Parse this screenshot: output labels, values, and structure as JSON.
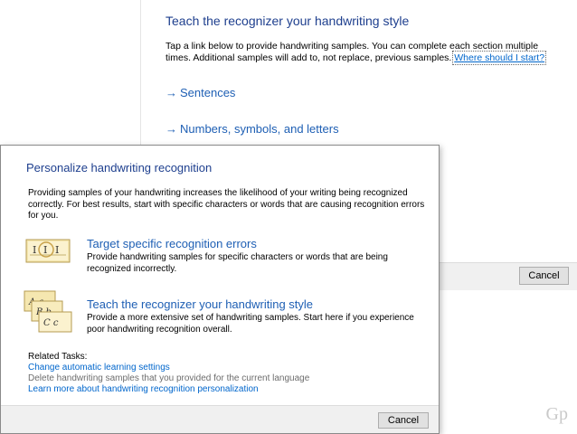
{
  "back": {
    "heading": "Teach the recognizer your handwriting style",
    "intro_text": "Tap a link below to provide handwriting samples. You can complete each section multiple times. Additional samples will add to, not replace, previous samples.",
    "intro_link": "Where should I start?",
    "arrow": "→",
    "sentences": "Sentences",
    "numbers": "Numbers, symbols, and letters",
    "cancel": "Cancel"
  },
  "front": {
    "title": "Personalize handwriting recognition",
    "description": "Providing samples of your handwriting increases the likelihood of your writing being recognized correctly. For best results, start with specific characters or words that are causing recognition errors for you.",
    "option1": {
      "title": "Target specific recognition errors",
      "desc": "Provide handwriting samples for specific characters or words that are being recognized incorrectly."
    },
    "option2": {
      "title": "Teach the recognizer your handwriting style",
      "desc": "Provide a more extensive set of handwriting samples. Start here if you experience poor handwriting recognition overall."
    },
    "related_label": "Related Tasks:",
    "related": [
      "Change automatic learning settings",
      "Delete handwriting samples that you provided for the current language",
      "Learn more about handwriting recognition personalization"
    ],
    "cancel": "Cancel"
  },
  "watermark": "Gp"
}
